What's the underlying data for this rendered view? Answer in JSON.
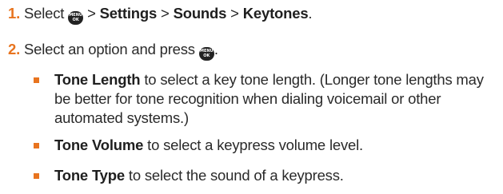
{
  "step1": {
    "number": "1.",
    "select": "Select",
    "sep1": ">",
    "settings": "Settings",
    "sep2": ">",
    "sounds": "Sounds",
    "sep3": ">",
    "keytones": "Keytones",
    "end": "."
  },
  "step2": {
    "number": "2.",
    "text": "Select an option and press",
    "end": "."
  },
  "key_icon": {
    "line1": "MENU",
    "line2": "OK"
  },
  "bullets": [
    {
      "term": "Tone Length",
      "text": " to select a key tone length. (Longer tone lengths may be better for tone recognition when dialing voicemail or other automated systems.)"
    },
    {
      "term": "Tone Volume",
      "text": " to select a keypress volume level."
    },
    {
      "term": "Tone Type",
      "text": " to select the sound of a keypress."
    }
  ],
  "colors": {
    "accent": "#e8741f",
    "text": "#2a2a2a",
    "icon_bg": "#222222"
  }
}
